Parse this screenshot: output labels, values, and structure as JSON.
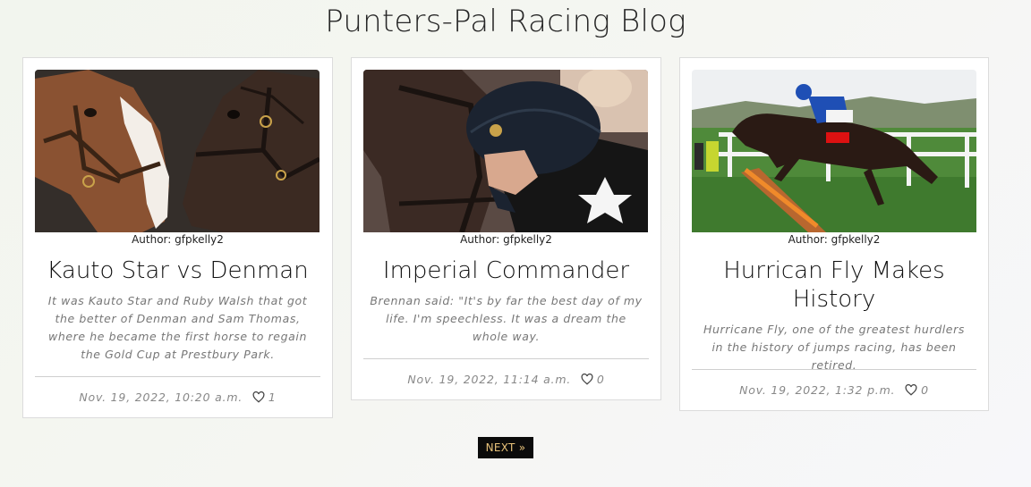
{
  "page": {
    "title": "Punters-Pal Racing Blog"
  },
  "posts": [
    {
      "author": "Author: gfpkelly2",
      "title": "Kauto Star vs Denman",
      "excerpt": "It was Kauto Star and Ruby Walsh that got the better of Denman and Sam Thomas, where he became the first horse to regain the Gold Cup at Prestbury Park.",
      "date": "Nov. 19, 2022, 10:20 a.m.",
      "likes": "1",
      "image": "two-horses-heads-photo"
    },
    {
      "author": "Author: gfpkelly2",
      "title": "Imperial Commander",
      "excerpt": "Brennan said: \"It's by far the best day of my life. I'm speechless. It was a dream the whole way.",
      "date": "Nov. 19, 2022, 11:14 a.m.",
      "likes": "0",
      "image": "jockey-kissing-horse-photo"
    },
    {
      "author": "Author: gfpkelly2",
      "title": "Hurrican Fly Makes History",
      "excerpt": "Hurricane Fly, one of the greatest hurdlers in the history of jumps racing, has been retired.",
      "date": "Nov. 19, 2022, 1:32 p.m.",
      "likes": "0",
      "image": "horse-jumping-hurdle-photo"
    }
  ],
  "pagination": {
    "next_label": "NEXT »"
  },
  "colors": {
    "next_bg": "#0b0b0b",
    "next_text": "#e7c27a"
  }
}
